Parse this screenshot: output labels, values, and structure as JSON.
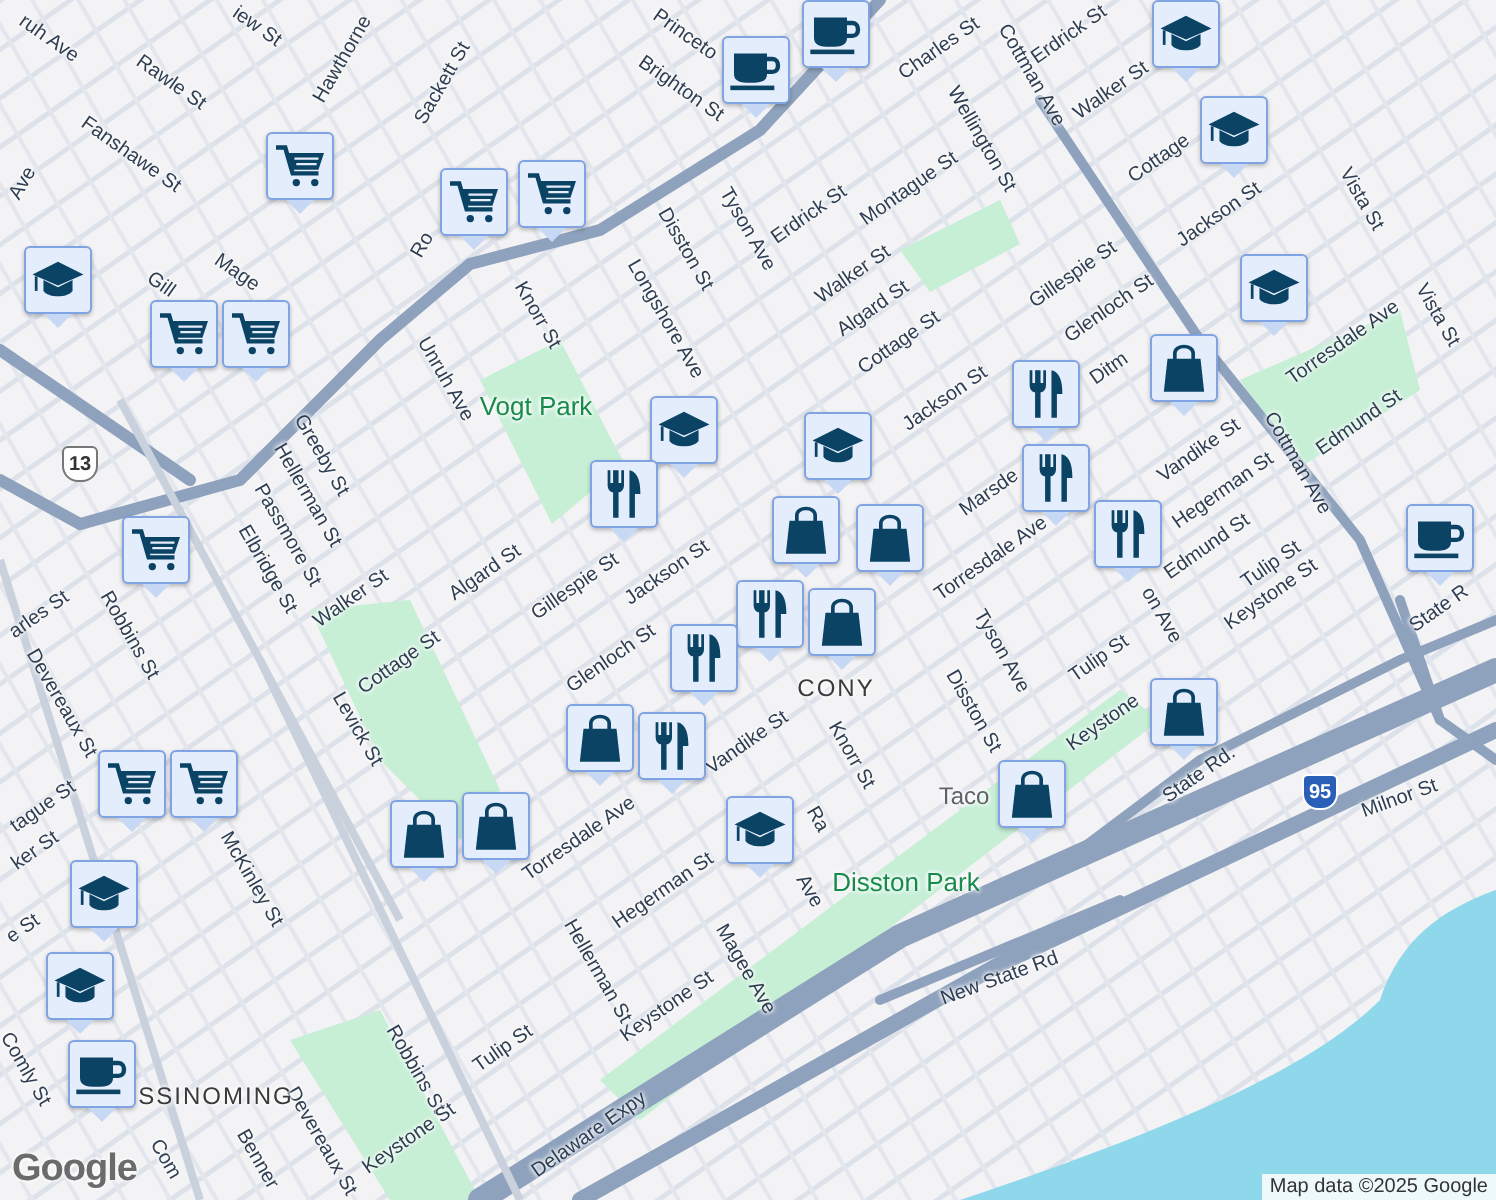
{
  "map": {
    "labels": [
      {
        "text": "ruh Ave",
        "kind": "street"
      },
      {
        "text": "iew St",
        "kind": "street"
      },
      {
        "text": "Hawthorne",
        "kind": "street"
      },
      {
        "text": "Rawle St",
        "kind": "street"
      },
      {
        "text": "Sackett St",
        "kind": "street"
      },
      {
        "text": "Fanshawe St",
        "kind": "street"
      },
      {
        "text": "Ave",
        "kind": "street"
      },
      {
        "text": "Princeto",
        "kind": "street"
      },
      {
        "text": "Brighton St",
        "kind": "street"
      },
      {
        "text": "Gill",
        "kind": "street"
      },
      {
        "text": "Mage",
        "kind": "street"
      },
      {
        "text": "Ro",
        "kind": "street"
      },
      {
        "text": "Knorr St",
        "kind": "street"
      },
      {
        "text": "Unruh Ave",
        "kind": "street"
      },
      {
        "text": "Disston St",
        "kind": "street"
      },
      {
        "text": "Longshore Ave",
        "kind": "street"
      },
      {
        "text": "Tyson Ave",
        "kind": "street"
      },
      {
        "text": "Vogt Park",
        "kind": "park"
      },
      {
        "text": "Greeby St",
        "kind": "street"
      },
      {
        "text": "Hellerman St",
        "kind": "street"
      },
      {
        "text": "Passmore St",
        "kind": "street"
      },
      {
        "text": "Elbridge St",
        "kind": "street"
      },
      {
        "text": "Robbins St",
        "kind": "street"
      },
      {
        "text": "Walker St",
        "kind": "street"
      },
      {
        "text": "Algard St",
        "kind": "street"
      },
      {
        "text": "Gillespie St",
        "kind": "street"
      },
      {
        "text": "Jackson St",
        "kind": "street"
      },
      {
        "text": "Cottage St",
        "kind": "street"
      },
      {
        "text": "Glenloch St",
        "kind": "street"
      },
      {
        "text": "Levick St",
        "kind": "street"
      },
      {
        "text": "Devereaux St",
        "kind": "street"
      },
      {
        "text": "arles St",
        "kind": "street"
      },
      {
        "text": "tague St",
        "kind": "street"
      },
      {
        "text": "ker St",
        "kind": "street"
      },
      {
        "text": "McKinley St",
        "kind": "street"
      },
      {
        "text": "Torresdale Ave",
        "kind": "street"
      },
      {
        "text": "Hellerman St",
        "kind": "street"
      },
      {
        "text": "Hegerman St",
        "kind": "street"
      },
      {
        "text": "Vandike St",
        "kind": "street"
      },
      {
        "text": "Magee Ave",
        "kind": "street"
      },
      {
        "text": "Keystone St",
        "kind": "street"
      },
      {
        "text": "Tulip St",
        "kind": "street"
      },
      {
        "text": "Robbins St",
        "kind": "street"
      },
      {
        "text": "Devereaux St",
        "kind": "street"
      },
      {
        "text": "Keystone St",
        "kind": "street"
      },
      {
        "text": "Delaware Expy",
        "kind": "street"
      },
      {
        "text": "SSINOMING",
        "kind": "area"
      },
      {
        "text": "Comly St",
        "kind": "street"
      },
      {
        "text": "Benner",
        "kind": "street"
      },
      {
        "text": "Com",
        "kind": "street"
      },
      {
        "text": "e St",
        "kind": "street"
      },
      {
        "text": "Cottman Ave",
        "kind": "street"
      },
      {
        "text": "Erdrick St",
        "kind": "street"
      },
      {
        "text": "Charles St",
        "kind": "street"
      },
      {
        "text": "Wellington St",
        "kind": "street"
      },
      {
        "text": "Walker St",
        "kind": "street"
      },
      {
        "text": "Cottage",
        "kind": "street"
      },
      {
        "text": "Montague St",
        "kind": "street"
      },
      {
        "text": "Erdrick St",
        "kind": "street"
      },
      {
        "text": "Jackson St",
        "kind": "street"
      },
      {
        "text": "Vista St",
        "kind": "street"
      },
      {
        "text": "Vista St",
        "kind": "street"
      },
      {
        "text": "Walker St",
        "kind": "street"
      },
      {
        "text": "Algard St",
        "kind": "street"
      },
      {
        "text": "Gillespie St",
        "kind": "street"
      },
      {
        "text": "Cottage St",
        "kind": "street"
      },
      {
        "text": "Glenloch St",
        "kind": "street"
      },
      {
        "text": "Jackson St",
        "kind": "street"
      },
      {
        "text": "Ditm",
        "kind": "street"
      },
      {
        "text": "Torresdale Ave",
        "kind": "street"
      },
      {
        "text": "Edmund St",
        "kind": "street"
      },
      {
        "text": "Cottman Ave",
        "kind": "street"
      },
      {
        "text": "Vandike St",
        "kind": "street"
      },
      {
        "text": "Hegerman St",
        "kind": "street"
      },
      {
        "text": "Edmund St",
        "kind": "street"
      },
      {
        "text": "Tulip St",
        "kind": "street"
      },
      {
        "text": "Keystone St",
        "kind": "street"
      },
      {
        "text": "Marsde",
        "kind": "street"
      },
      {
        "text": "Torresdale Ave",
        "kind": "street"
      },
      {
        "text": "Tyson Ave",
        "kind": "street"
      },
      {
        "text": "Disston St",
        "kind": "street"
      },
      {
        "text": "Knorr St",
        "kind": "street"
      },
      {
        "text": "Ra",
        "kind": "street"
      },
      {
        "text": "CONY",
        "kind": "area"
      },
      {
        "text": "Taco",
        "kind": "place"
      },
      {
        "text": "Disston Park",
        "kind": "park"
      },
      {
        "text": "Keystone",
        "kind": "street"
      },
      {
        "text": "Tulip St",
        "kind": "street"
      },
      {
        "text": "on Ave",
        "kind": "street"
      },
      {
        "text": "State Rd.",
        "kind": "street"
      },
      {
        "text": "State R",
        "kind": "street"
      },
      {
        "text": "Milnor St",
        "kind": "street"
      },
      {
        "text": "New State Rd",
        "kind": "street"
      },
      {
        "text": "Ave",
        "kind": "street"
      }
    ],
    "route_shields": [
      {
        "text": "13",
        "kind": "us"
      },
      {
        "text": "95",
        "kind": "interstate"
      }
    ],
    "pins": [
      {
        "kind": "coffee"
      },
      {
        "kind": "coffee"
      },
      {
        "kind": "school"
      },
      {
        "kind": "school"
      },
      {
        "kind": "cart"
      },
      {
        "kind": "cart"
      },
      {
        "kind": "cart"
      },
      {
        "kind": "school"
      },
      {
        "kind": "cart"
      },
      {
        "kind": "cart"
      },
      {
        "kind": "school"
      },
      {
        "kind": "school"
      },
      {
        "kind": "shop"
      },
      {
        "kind": "food"
      },
      {
        "kind": "food"
      },
      {
        "kind": "food"
      },
      {
        "kind": "school"
      },
      {
        "kind": "shop"
      },
      {
        "kind": "shop"
      },
      {
        "kind": "food"
      },
      {
        "kind": "shop"
      },
      {
        "kind": "food"
      },
      {
        "kind": "cart"
      },
      {
        "kind": "food"
      },
      {
        "kind": "shop"
      },
      {
        "kind": "food"
      },
      {
        "kind": "cart"
      },
      {
        "kind": "cart"
      },
      {
        "kind": "shop"
      },
      {
        "kind": "shop"
      },
      {
        "kind": "school"
      },
      {
        "kind": "shop"
      },
      {
        "kind": "shop"
      },
      {
        "kind": "coffee"
      },
      {
        "kind": "school"
      },
      {
        "kind": "school"
      },
      {
        "kind": "coffee"
      }
    ]
  },
  "logo": "Google",
  "attribution": "Map data ©2025 Google"
}
